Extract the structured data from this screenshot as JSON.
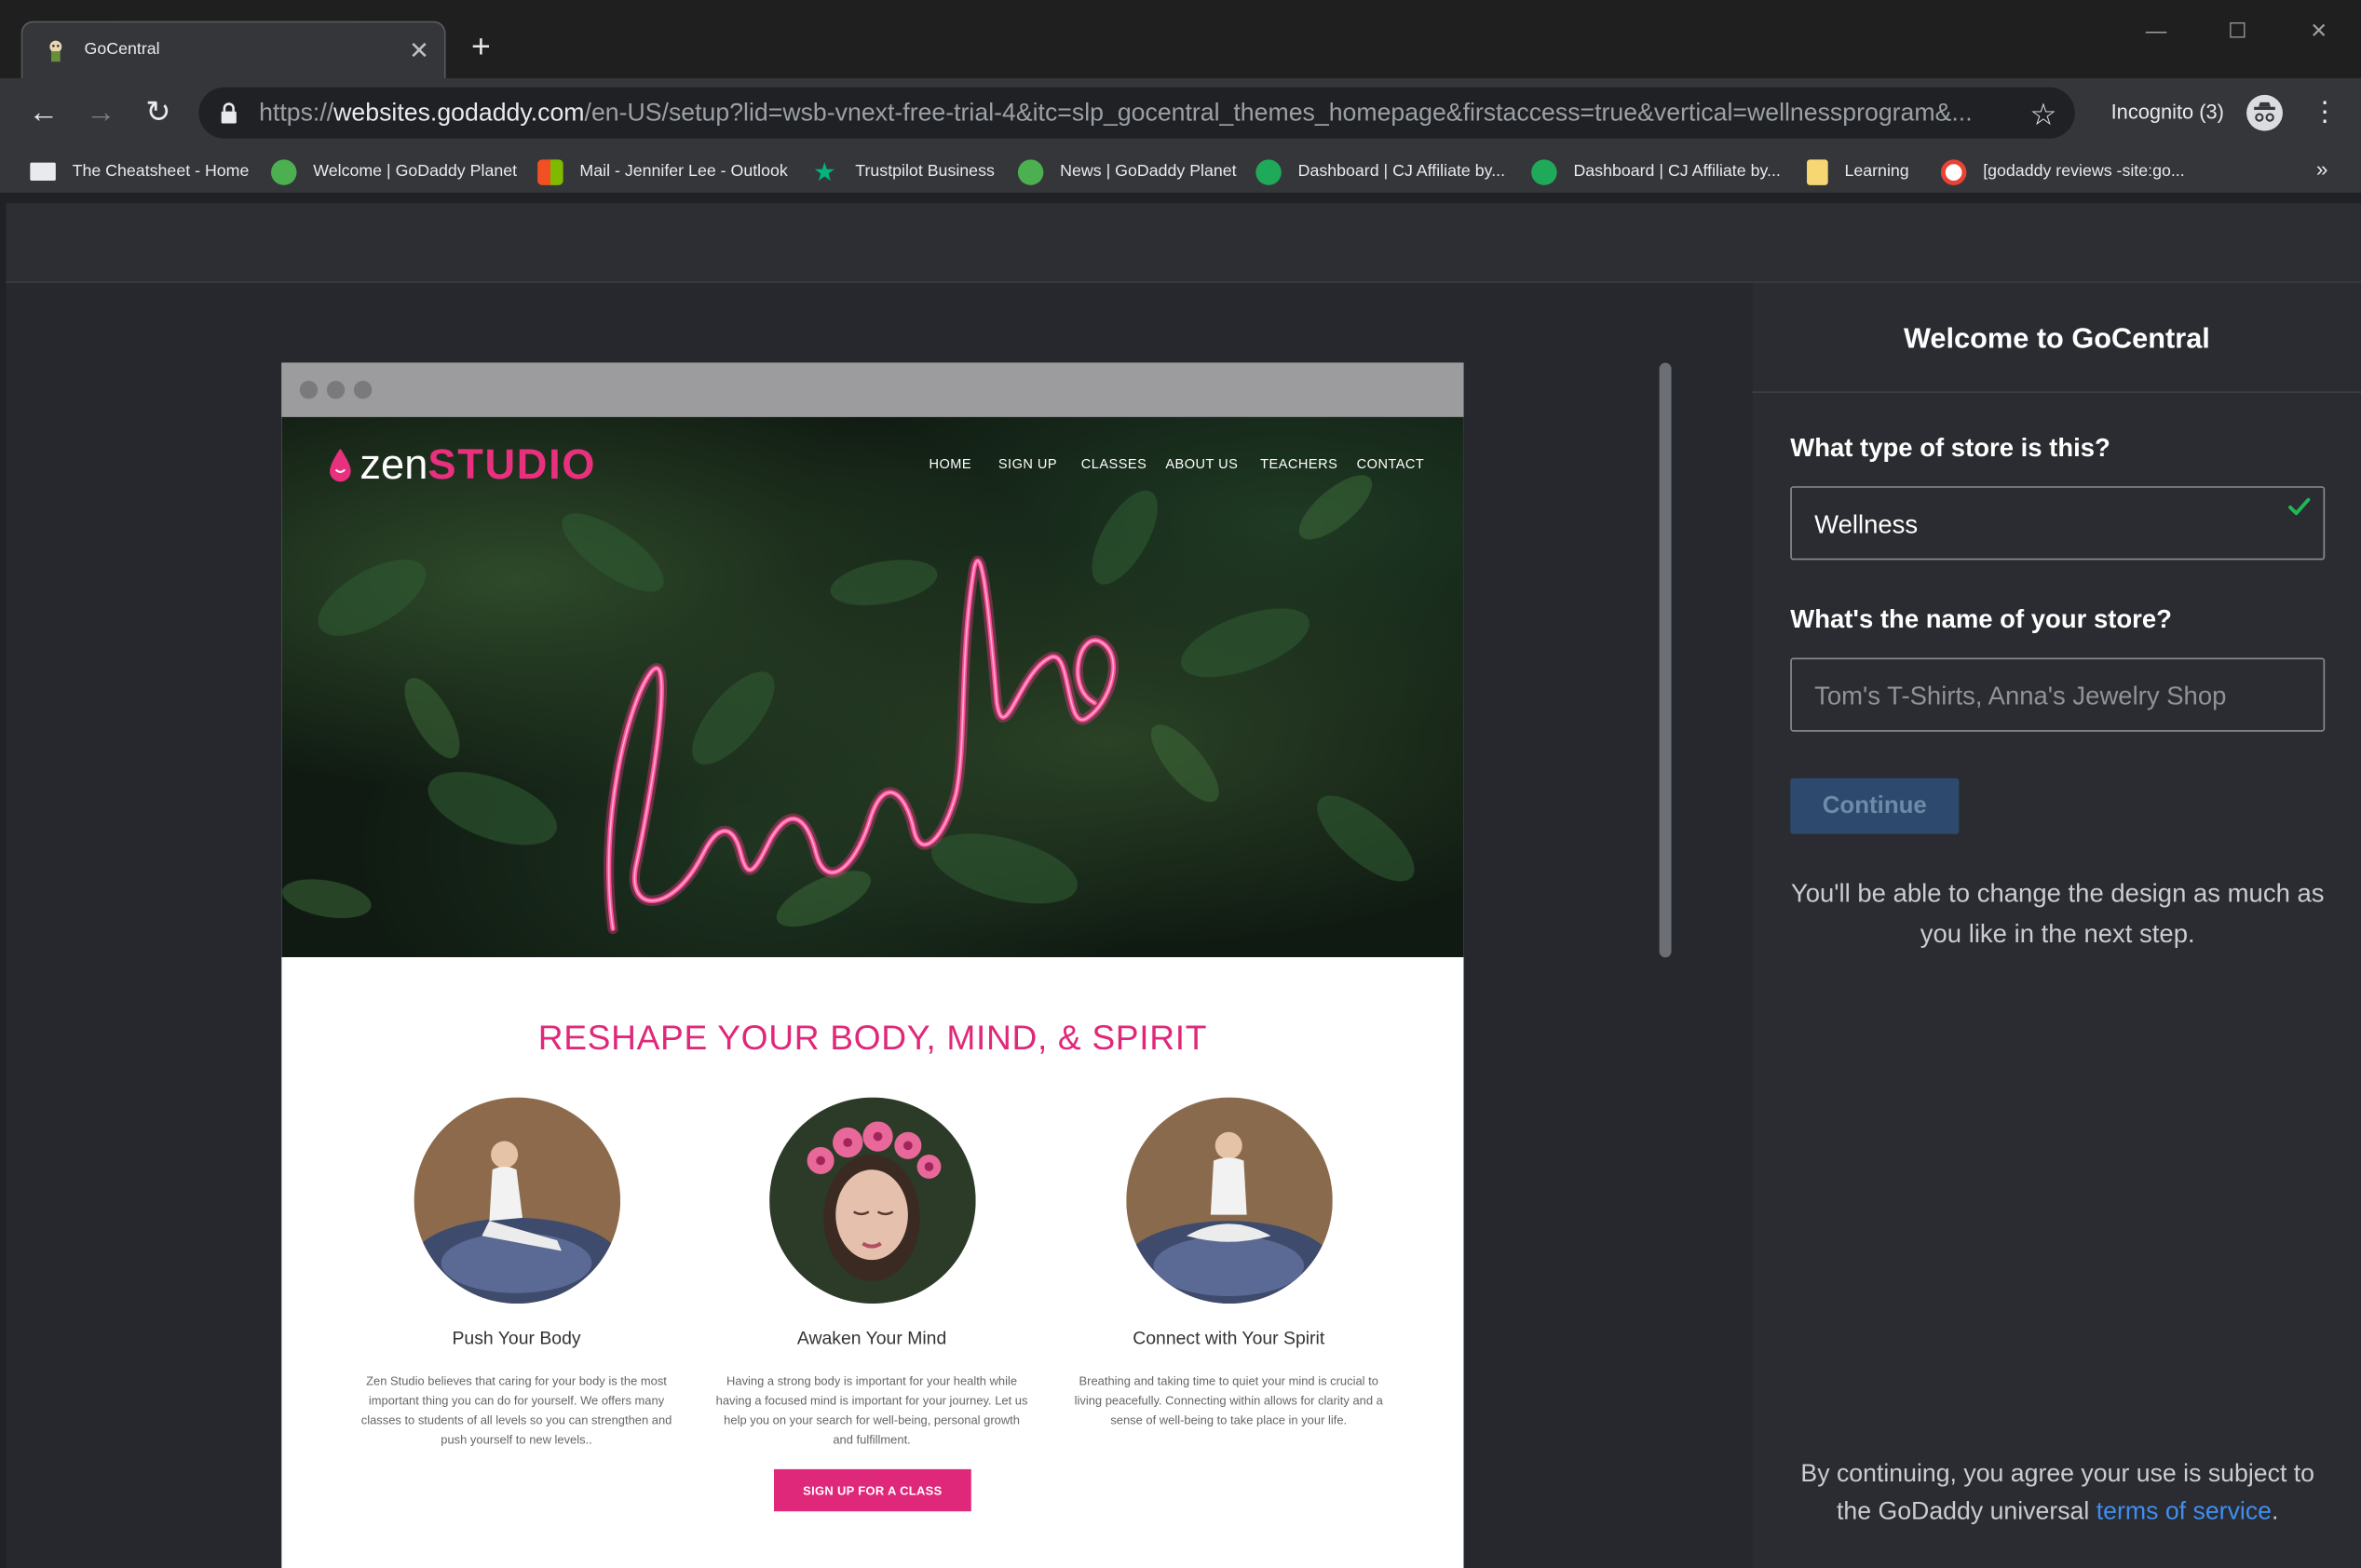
{
  "browser": {
    "tab_title": "GoCentral",
    "url_scheme": "https://",
    "url_host": "websites.godaddy.com",
    "url_path": "/en-US/setup?lid=wsb-vnext-free-trial-4&itc=slp_gocentral_themes_homepage&firstaccess=true&vertical=wellnessprogram&...",
    "incognito_label": "Incognito (3)"
  },
  "bookmarks": [
    {
      "label": "The Cheatsheet - Home",
      "icon": "cheatsheet-icon"
    },
    {
      "label": "Welcome | GoDaddy Planet",
      "icon": "globe-icon"
    },
    {
      "label": "Mail - Jennifer Lee - Outlook",
      "icon": "microsoft-icon"
    },
    {
      "label": "Trustpilot Business",
      "icon": "star-icon"
    },
    {
      "label": "News | GoDaddy Planet",
      "icon": "globe-icon"
    },
    {
      "label": "Dashboard | CJ Affiliate by...",
      "icon": "cj-icon"
    },
    {
      "label": "Dashboard | CJ Affiliate by...",
      "icon": "cj-icon"
    },
    {
      "label": "Learning",
      "icon": "folder-icon"
    },
    {
      "label": "[godaddy reviews -site:go...",
      "icon": "google-icon"
    }
  ],
  "site": {
    "logo_zen": "zen",
    "logo_studio": "STUDIO",
    "nav": [
      "HOME",
      "SIGN UP",
      "CLASSES",
      "ABOUT US",
      "TEACHERS",
      "CONTACT"
    ],
    "headline": "RESHAPE YOUR BODY, MIND, & SPIRIT",
    "features": [
      {
        "title": "Push Your Body",
        "text": "Zen Studio believes that caring for your body is the most important thing you can do for yourself. We offers many classes to students of all levels so you can strengthen and push yourself to new levels.."
      },
      {
        "title": "Awaken Your Mind",
        "text": "Having a strong body is important for your health while having a focused mind is important for your journey. Let us help you on your search for well-being, personal growth and fulfillment."
      },
      {
        "title": "Connect with Your Spirit",
        "text": "Breathing and taking time to quiet your mind is crucial to living peacefully. Connecting within allows for clarity and a sense of well-being to take place in your life."
      }
    ],
    "cta": "SIGN UP FOR A CLASS"
  },
  "panel": {
    "title": "Welcome to GoCentral",
    "store_type_label": "What type of store is this?",
    "store_type_value": "Wellness",
    "store_name_label": "What's the name of your store?",
    "store_name_placeholder": "Tom's T-Shirts, Anna's Jewelry Shop",
    "continue_label": "Continue",
    "note": "You'll be able to change the design as much as you like in the next step.",
    "terms_prefix": "By continuing, you agree your use is subject to the GoDaddy universal ",
    "terms_link": "terms of service",
    "terms_suffix": "."
  },
  "colors": {
    "accent_pink": "#e0287a",
    "link_blue": "#3f8ef0",
    "check_green": "#1db954"
  }
}
